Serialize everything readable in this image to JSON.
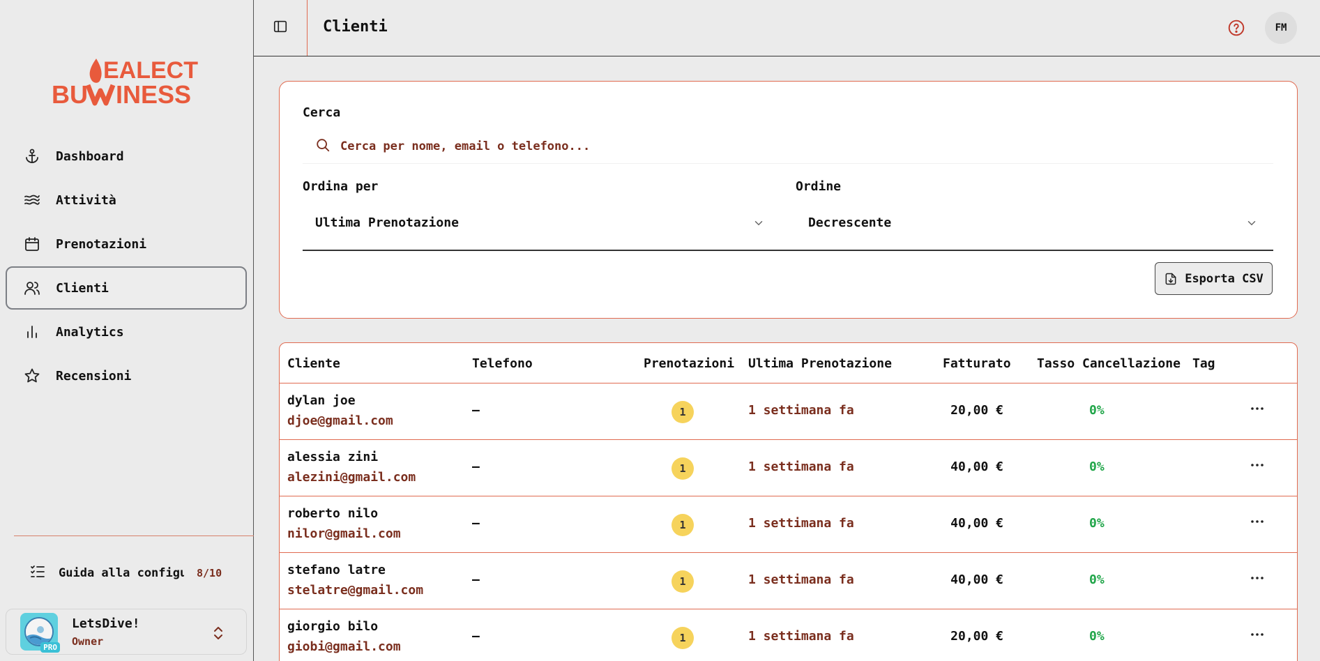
{
  "app": {
    "logo_text_line1": "SEALECT",
    "logo_text_line2": "BUSINESS",
    "brand_color": "#e85a3c"
  },
  "sidebar": {
    "items": [
      {
        "label": "Dashboard",
        "icon": "anchor-icon",
        "active": false
      },
      {
        "label": "Attività",
        "icon": "waves-icon",
        "active": false
      },
      {
        "label": "Prenotazioni",
        "icon": "calendar-icon",
        "active": false
      },
      {
        "label": "Clienti",
        "icon": "users-icon",
        "active": true
      },
      {
        "label": "Analytics",
        "icon": "bar-chart-icon",
        "active": false
      },
      {
        "label": "Recensioni",
        "icon": "star-icon",
        "active": false
      }
    ],
    "guide": {
      "label": "Guida alla configu…",
      "count": "8/10",
      "icon": "checklist-icon"
    },
    "account": {
      "name": "LetsDive!",
      "role": "Owner",
      "badge": "PRO"
    }
  },
  "header": {
    "title": "Clienti",
    "user_initials": "FM"
  },
  "filters": {
    "search_label": "Cerca",
    "search_placeholder": "Cerca per nome, email o telefono...",
    "sort_label": "Ordina per",
    "sort_value": "Ultima Prenotazione",
    "order_label": "Ordine",
    "order_value": "Decrescente",
    "export_label": "Esporta CSV"
  },
  "table": {
    "columns": [
      "Cliente",
      "Telefono",
      "Prenotazioni",
      "Ultima Prenotazione",
      "Fatturato",
      "Tasso Cancellazione",
      "Tag"
    ],
    "rows": [
      {
        "name": "dylan joe",
        "email": "djoe@gmail.com",
        "phone": "–",
        "bookings": "1",
        "last": "1 settimana fa",
        "revenue": "20,00 €",
        "cancel_rate": "0%"
      },
      {
        "name": "alessia zini",
        "email": "alezini@gmail.com",
        "phone": "–",
        "bookings": "1",
        "last": "1 settimana fa",
        "revenue": "40,00 €",
        "cancel_rate": "0%"
      },
      {
        "name": "roberto nilo",
        "email": "nilor@gmail.com",
        "phone": "–",
        "bookings": "1",
        "last": "1 settimana fa",
        "revenue": "40,00 €",
        "cancel_rate": "0%"
      },
      {
        "name": "stefano latre",
        "email": "stelatre@gmail.com",
        "phone": "–",
        "bookings": "1",
        "last": "1 settimana fa",
        "revenue": "40,00 €",
        "cancel_rate": "0%"
      },
      {
        "name": "giorgio bilo",
        "email": "giobi@gmail.com",
        "phone": "–",
        "bookings": "1",
        "last": "1 settimana fa",
        "revenue": "20,00 €",
        "cancel_rate": "0%"
      }
    ]
  }
}
